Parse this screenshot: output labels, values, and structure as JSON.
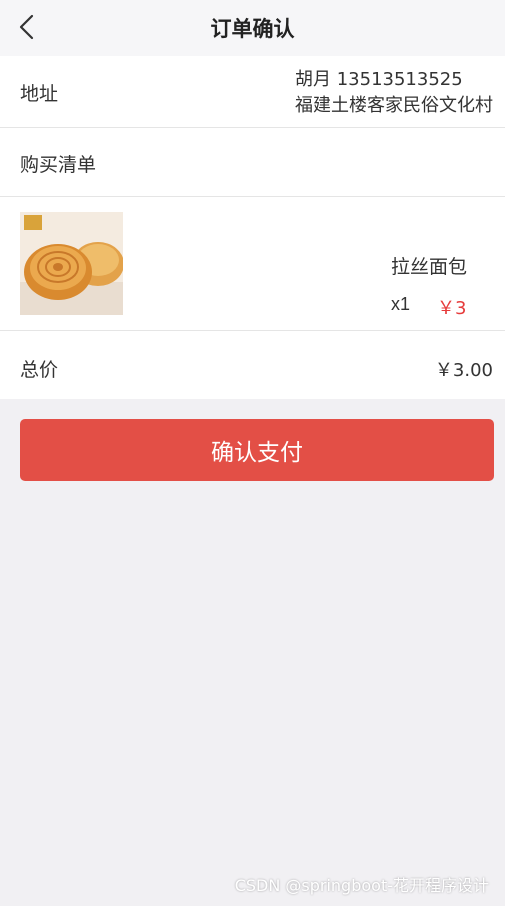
{
  "header": {
    "title": "订单确认",
    "back_icon": "chevron-left-icon"
  },
  "address": {
    "label": "地址",
    "name_phone": "胡月 13513513525",
    "detail": "福建土楼客家民俗文化村"
  },
  "purchase_list": {
    "label": "购买清单"
  },
  "product": {
    "name": "拉丝面包",
    "quantity": "x1",
    "price": "￥3"
  },
  "total": {
    "label": "总价",
    "value": "￥3.00"
  },
  "actions": {
    "pay_label": "确认支付"
  },
  "watermark": "CSDN @springboot-花开程序设计",
  "colors": {
    "accent": "#e34f46",
    "price": "#e63b3b",
    "background": "#f1f0f3"
  }
}
